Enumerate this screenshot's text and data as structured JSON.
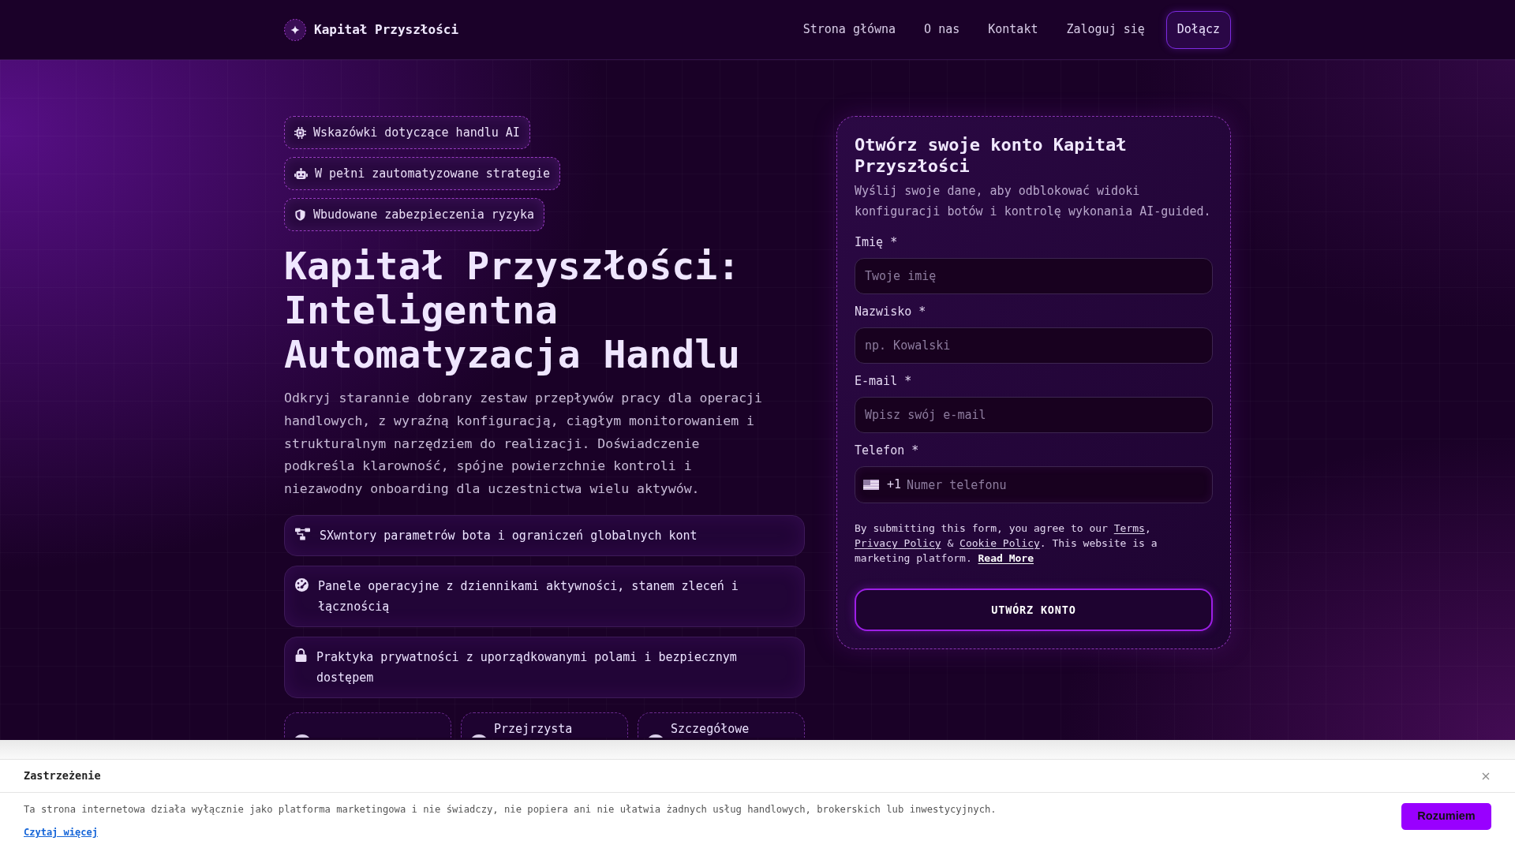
{
  "header": {
    "brand": "Kapitał Przyszłości",
    "nav": [
      {
        "label": "Strona główna"
      },
      {
        "label": "O nas"
      },
      {
        "label": "Kontakt"
      },
      {
        "label": "Zaloguj się"
      }
    ],
    "join_button": "Dołącz"
  },
  "hero": {
    "badges": [
      {
        "label": "Wskazówki dotyczące handlu AI"
      },
      {
        "label": "W pełni zautomatyzowane strategie"
      },
      {
        "label": "Wbudowane zabezpieczenia ryzyka"
      }
    ],
    "title": "Kapitał Przyszłości: Inteligentna Automatyzacja Handlu",
    "description": "Odkryj starannie dobrany zestaw przepływów pracy dla operacji handlowych, z wyraźną konfiguracją, ciągłym monitorowaniem i strukturalnym narzędziem do realizacji. Doświadczenie podkreśla klarowność, spójne powierzchnie kontroli i niezawodny onboarding dla uczestnictwa wielu aktywów.",
    "features": [
      {
        "text": "SXwntory parametrów bota i ograniczeń globalnych kont"
      },
      {
        "text": "Panele operacyjne z dziennikami aktywności, stanem zleceń i łącznością"
      },
      {
        "text": "Praktyka prywatności z uporządkowanymi polami i bezpiecznym dostępem"
      }
    ],
    "highlights": [
      {
        "kind": "covered"
      },
      {
        "kind": "titled",
        "title": "Przejrzysta"
      },
      {
        "kind": "titled",
        "title": "Szczegółowe"
      }
    ]
  },
  "signup_form": {
    "title": "Otwórz swoje konto Kapitał Przyszłości",
    "subtitle": "Wyślij swoje dane, aby odblokować widoki konfiguracji botów i kontrolę wykonania AI-guided.",
    "fields": [
      {
        "kind": "text",
        "label": "Imię *",
        "placeholder": "Twoje imię"
      },
      {
        "kind": "text",
        "label": "Nazwisko *",
        "placeholder": "np. Kowalski"
      },
      {
        "kind": "email",
        "label": "E-mail *",
        "placeholder": "Wpisz swój e-mail"
      },
      {
        "kind": "phone",
        "label": "Telefon *",
        "prefix": "+1",
        "placeholder": "Numer telefonu"
      }
    ],
    "consent": [
      {
        "kind": "text",
        "text": "By submitting this form, you agree to our "
      },
      {
        "kind": "link",
        "text": "Terms"
      },
      {
        "kind": "text",
        "text": ", "
      },
      {
        "kind": "link",
        "text": "Privacy Policy"
      },
      {
        "kind": "text",
        "text": " & "
      },
      {
        "kind": "link",
        "text": "Cookie Policy"
      },
      {
        "kind": "text",
        "text": ". This website is a marketing platform. "
      },
      {
        "kind": "strong_link",
        "text": "Read More"
      }
    ],
    "submit_button": "UTWÓRZ KONTO"
  },
  "disclaimer": {
    "title": "Zastrzeżenie",
    "text": "Ta strona internetowa działa wyłącznie jako platforma marketingowa i nie świadczy, nie popiera ani nie ułatwia żadnych usług handlowych, brokerskich lub inwestycyjnych.",
    "link": "Czytaj więcej",
    "button": "Rozumiem"
  }
}
